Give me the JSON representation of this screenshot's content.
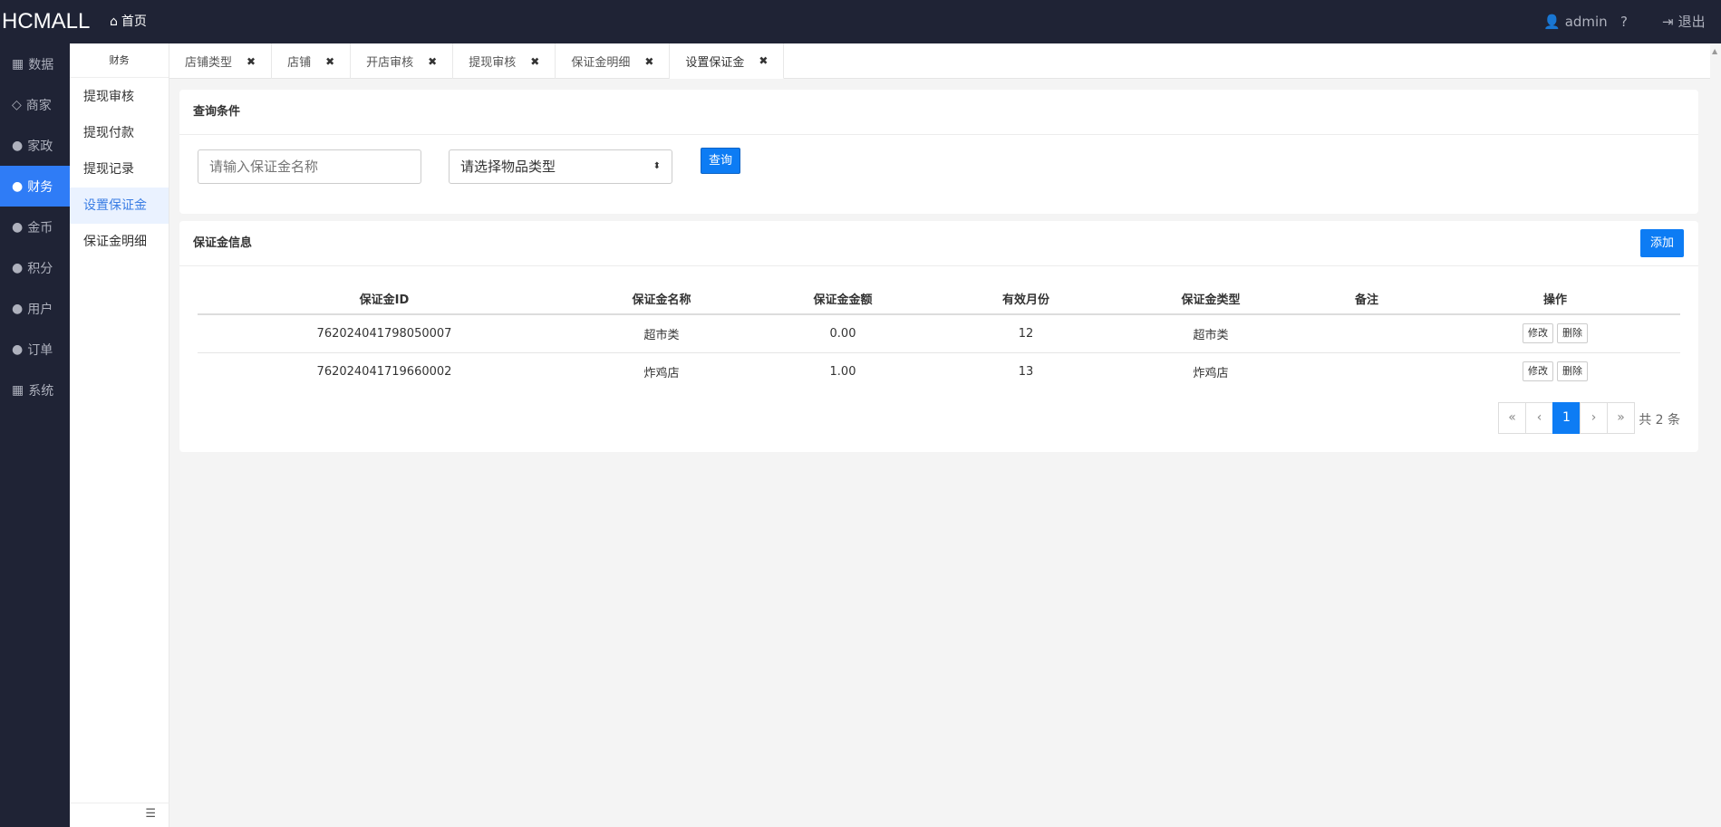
{
  "header": {
    "brand": "HCMALL",
    "home": "首页",
    "user": "admin",
    "logout": "退出"
  },
  "sidebar": {
    "items": [
      "数据",
      "商家",
      "家政",
      "财务",
      "金币",
      "积分",
      "用户",
      "订单",
      "系统"
    ],
    "active_index": 3
  },
  "subnav": {
    "title": "财务",
    "items": [
      "提现审核",
      "提现付款",
      "提现记录",
      "设置保证金",
      "保证金明细"
    ],
    "active_index": 3
  },
  "tabs": [
    "店铺类型",
    "店铺",
    "开店审核",
    "提现审核",
    "保证金明细",
    "设置保证金"
  ],
  "query": {
    "title": "查询条件",
    "name_placeholder": "请输入保证金名称",
    "type_select": "请选择物品类型",
    "search_label": "查询"
  },
  "list": {
    "title": "保证金信息",
    "add_label": "添加",
    "columns": [
      "保证金ID",
      "保证金名称",
      "保证金金额",
      "有效月份",
      "保证金类型",
      "备注",
      "操作"
    ],
    "rows": [
      {
        "id": "762024041798050007",
        "name": "超市类",
        "amount": "0.00",
        "months": "12",
        "type": "超市类",
        "remark": ""
      },
      {
        "id": "762024041719660002",
        "name": "炸鸡店",
        "amount": "1.00",
        "months": "13",
        "type": "炸鸡店",
        "remark": ""
      }
    ],
    "edit_label": "修改",
    "delete_label": "删除"
  },
  "pagination": {
    "first": "«",
    "prev": "‹",
    "current": "1",
    "next": "›",
    "last": "»",
    "total_text": "共 2 条"
  },
  "colors": {
    "topbar": "#1f2335",
    "accent": "#0d7cf4",
    "active_nav": "#2f7cf6"
  }
}
